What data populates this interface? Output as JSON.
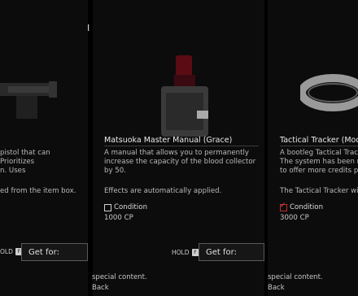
{
  "panels": {
    "left": {
      "desc_lines": [
        "pistol that can",
        "Prioritizes",
        "n. Uses"
      ],
      "note": "ed from the item box.",
      "hold_label": "OLD",
      "hold_key": "F",
      "getfor_label": "Get for:",
      "bottom_text": ""
    },
    "middle": {
      "title": "Matsuoka Master Manual (Grace)",
      "desc_lines": [
        "A manual that allows you to permanently",
        "increase the capacity of the blood collector",
        "by 50."
      ],
      "note": "Effects are automatically applied.",
      "condition_label": "Condition",
      "condition_checked": false,
      "cost": "1000 CP",
      "hold_label": "HOLD",
      "hold_key": "F",
      "getfor_label": "Get for:",
      "bottom_line1": "special content.",
      "bottom_line2": "Back"
    },
    "right": {
      "title": "Tactical Tracker (Modded",
      "desc_lines": [
        "A bootleg Tactical Tracker",
        "The system has been mod",
        "to offer more credits per"
      ],
      "note": "The Tactical Tracker will c",
      "condition_label": "Condition",
      "condition_checked": true,
      "cost": "3000 CP",
      "bottom_line1": "special content.",
      "bottom_line2": "Back"
    }
  },
  "header_glyph": "I",
  "colors": {
    "check": "#e04040",
    "accent_item": "#6a1018"
  }
}
